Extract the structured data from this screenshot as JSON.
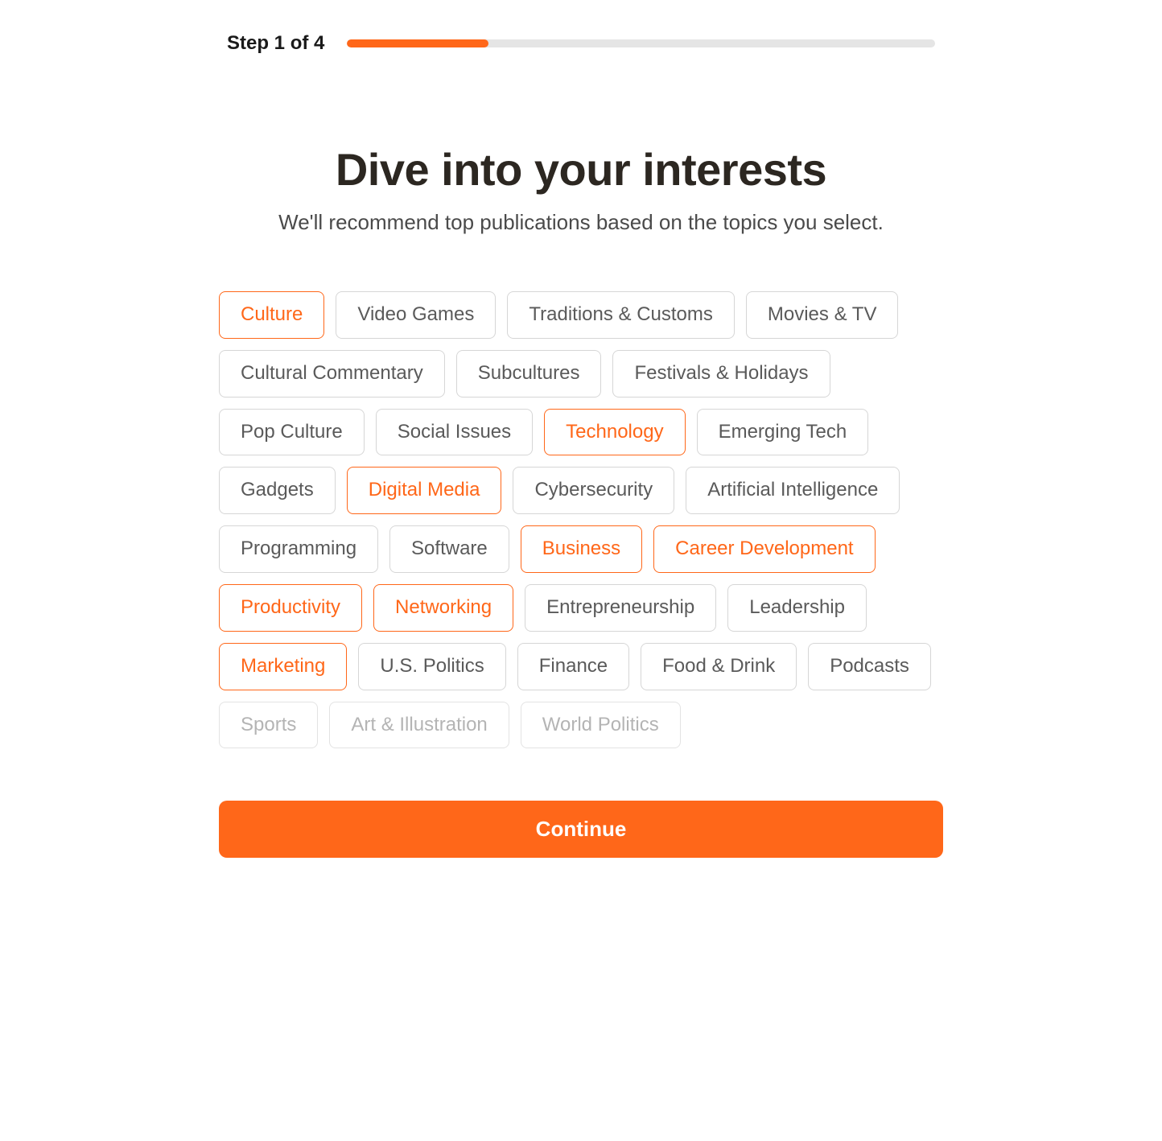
{
  "progress": {
    "step_label": "Step 1 of 4",
    "percent": 24
  },
  "heading": "Dive into your interests",
  "subheading": "We'll recommend top publications based on the topics you select.",
  "topics": [
    {
      "label": "Culture",
      "selected": true,
      "faded": false
    },
    {
      "label": "Video Games",
      "selected": false,
      "faded": false
    },
    {
      "label": "Traditions & Customs",
      "selected": false,
      "faded": false
    },
    {
      "label": "Movies & TV",
      "selected": false,
      "faded": false
    },
    {
      "label": "Cultural Commentary",
      "selected": false,
      "faded": false
    },
    {
      "label": "Subcultures",
      "selected": false,
      "faded": false
    },
    {
      "label": "Festivals & Holidays",
      "selected": false,
      "faded": false
    },
    {
      "label": "Pop Culture",
      "selected": false,
      "faded": false
    },
    {
      "label": "Social Issues",
      "selected": false,
      "faded": false
    },
    {
      "label": "Technology",
      "selected": true,
      "faded": false
    },
    {
      "label": "Emerging Tech",
      "selected": false,
      "faded": false
    },
    {
      "label": "Gadgets",
      "selected": false,
      "faded": false
    },
    {
      "label": "Digital Media",
      "selected": true,
      "faded": false
    },
    {
      "label": "Cybersecurity",
      "selected": false,
      "faded": false
    },
    {
      "label": "Artificial Intelligence",
      "selected": false,
      "faded": false
    },
    {
      "label": "Programming",
      "selected": false,
      "faded": false
    },
    {
      "label": "Software",
      "selected": false,
      "faded": false
    },
    {
      "label": "Business",
      "selected": true,
      "faded": false
    },
    {
      "label": "Career Development",
      "selected": true,
      "faded": false
    },
    {
      "label": "Productivity",
      "selected": true,
      "faded": false
    },
    {
      "label": "Networking",
      "selected": true,
      "faded": false
    },
    {
      "label": "Entrepreneurship",
      "selected": false,
      "faded": false
    },
    {
      "label": "Leadership",
      "selected": false,
      "faded": false
    },
    {
      "label": "Marketing",
      "selected": true,
      "faded": false
    },
    {
      "label": "U.S. Politics",
      "selected": false,
      "faded": false
    },
    {
      "label": "Finance",
      "selected": false,
      "faded": false
    },
    {
      "label": "Food & Drink",
      "selected": false,
      "faded": false
    },
    {
      "label": "Podcasts",
      "selected": false,
      "faded": false
    },
    {
      "label": "Sports",
      "selected": false,
      "faded": true
    },
    {
      "label": "Art & Illustration",
      "selected": false,
      "faded": true
    },
    {
      "label": "World Politics",
      "selected": false,
      "faded": true
    }
  ],
  "continue_label": "Continue"
}
